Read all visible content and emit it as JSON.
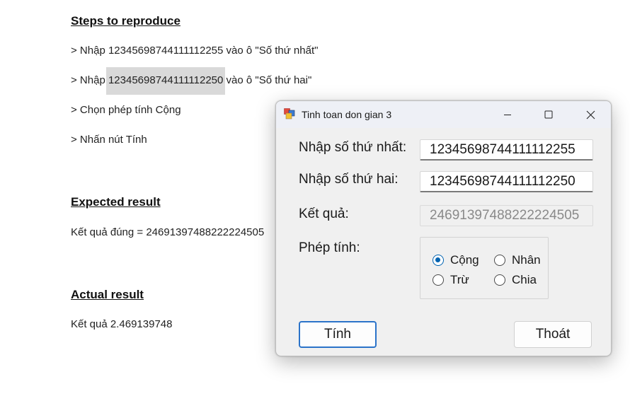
{
  "document": {
    "steps_heading": "Steps to reproduce",
    "step1": "> Nhập 12345698744111112255 vào ô \"Số thứ nhất\"",
    "step2_prefix": "> Nhập ",
    "step2_highlight": "12345698744111112250",
    "step2_suffix": " vào ô \"Số thứ hai\"",
    "step3": "> Chọn phép tính Cộng",
    "step4": "> Nhấn nút Tính",
    "expected_heading": "Expected result",
    "expected_text": "Kết quả đúng = 24691397488222224505",
    "actual_heading": "Actual result",
    "actual_text": "Kết quả 2.469139748"
  },
  "dialog": {
    "title": "Tinh toan don gian 3",
    "icons": {
      "app": "winforms-app-icon",
      "minimize": "minimize-icon",
      "maximize": "maximize-icon",
      "close": "close-icon"
    },
    "first_label": "Nhập số thứ nhất:",
    "first_value": "12345698744111112255",
    "second_label": "Nhập số thứ hai:",
    "second_value": "12345698744111112250",
    "result_label": "Kết quả:",
    "result_value": "24691397488222224505",
    "operation_label": "Phép tính:",
    "operations": [
      {
        "label": "Cộng",
        "selected": true
      },
      {
        "label": "Nhân",
        "selected": false
      },
      {
        "label": "Trừ",
        "selected": false
      },
      {
        "label": "Chia",
        "selected": false
      }
    ],
    "compute_button": "Tính",
    "exit_button": "Thoát",
    "colors": {
      "accent": "#0063b1",
      "primary_border": "#2b73c9",
      "titlebar": "#eef0f6",
      "window_bg": "#f0f0f0"
    }
  }
}
